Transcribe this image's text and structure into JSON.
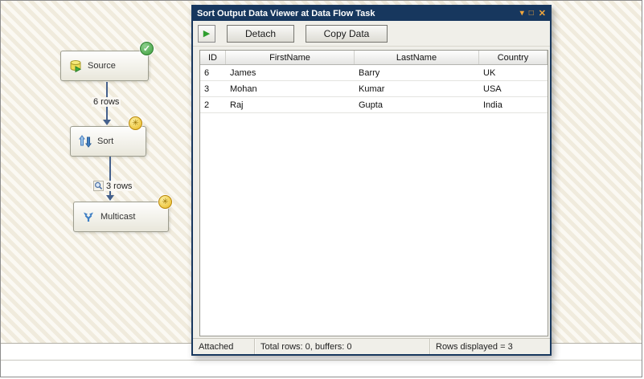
{
  "designer": {
    "components": [
      {
        "label": "Source",
        "icon": "database-source-icon"
      },
      {
        "label": "Sort",
        "icon": "sort-arrows-icon"
      },
      {
        "label": "Multicast",
        "icon": "multicast-branch-icon"
      }
    ],
    "edges": [
      {
        "label": "6 rows"
      },
      {
        "label": "3 rows"
      }
    ],
    "badges": {
      "check": "✓",
      "sun": "✳"
    }
  },
  "dialog": {
    "title": "Sort Output Data Viewer at Data Flow Task",
    "window_icons": {
      "pin": "▾",
      "maximize": "□",
      "close": "✕"
    },
    "toolbar": {
      "play": "▶",
      "detach_label": "Detach",
      "copy_label": "Copy Data"
    },
    "grid": {
      "columns": [
        "ID",
        "FirstName",
        "LastName",
        "Country"
      ],
      "rows": [
        [
          "6",
          "James",
          "Barry",
          "UK"
        ],
        [
          "3",
          "Mohan",
          "Kumar",
          "USA"
        ],
        [
          "2",
          "Raj",
          "Gupta",
          "India"
        ]
      ]
    },
    "status": {
      "attached": "Attached",
      "totals": "Total rows: 0, buffers: 0",
      "displayed": "Rows displayed = 3"
    }
  },
  "colors": {
    "title_bar": "#17375e",
    "dialog_border": "#17375e",
    "play_green": "#2e9e2e",
    "badge_green": "#3c9e3c",
    "badge_gold": "#e8b820",
    "edge_line": "#44608c"
  }
}
